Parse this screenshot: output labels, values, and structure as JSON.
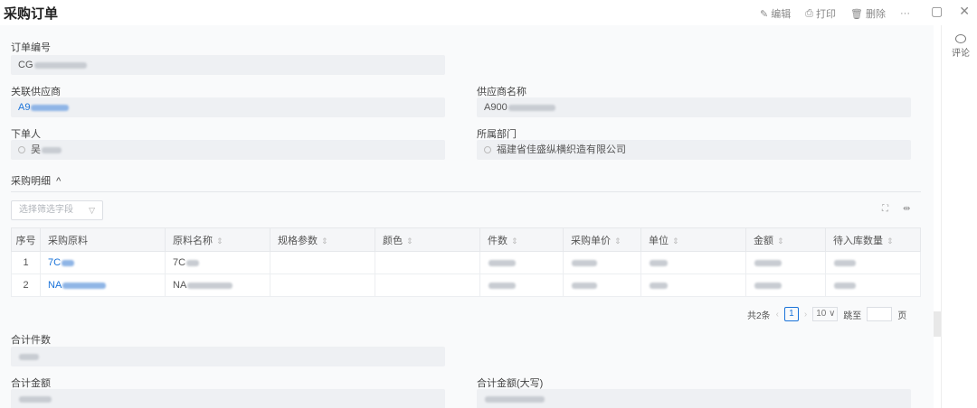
{
  "header": {
    "title": "采购订单",
    "actions": {
      "edit": "编辑",
      "print": "打印",
      "delete": "删除",
      "more": "···"
    }
  },
  "right_rail": {
    "comment": "评论"
  },
  "fields": {
    "order_no": {
      "label": "订单编号",
      "value": "CG"
    },
    "supplier": {
      "label": "关联供应商",
      "value": "A9"
    },
    "supplier_name": {
      "label": "供应商名称",
      "value": "A900"
    },
    "orderer": {
      "label": "下单人",
      "value": "吴"
    },
    "department": {
      "label": "所属部门",
      "value": "福建省佳盛纵横织造有限公司"
    },
    "total_qty": {
      "label": "合计件数",
      "value": ""
    },
    "total_amount": {
      "label": "合计金额",
      "value": ""
    },
    "total_amount_cn": {
      "label": "合计金额(大写)",
      "value": ""
    }
  },
  "section": {
    "title": "采购明细",
    "toggle": "^"
  },
  "filter": {
    "placeholder": "选择筛选字段"
  },
  "table": {
    "headers": [
      "序号",
      "采购原料",
      "原料名称",
      "规格参数",
      "颜色",
      "件数",
      "采购单价",
      "单位",
      "金额",
      "待入库数量"
    ],
    "rows": [
      {
        "idx": "1",
        "material": "7C",
        "name": "7C"
      },
      {
        "idx": "2",
        "material": "NA",
        "name": "NA"
      }
    ]
  },
  "pager": {
    "total": "共2条",
    "page": "1",
    "size": "10",
    "goto": "跳至",
    "page_unit": "页"
  },
  "colors": {
    "accent": "#1a73d9",
    "field_bg": "#eef0f3"
  }
}
